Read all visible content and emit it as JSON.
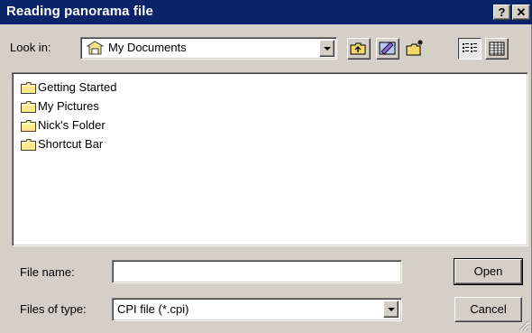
{
  "window": {
    "title": "Reading panorama file",
    "help_glyph": "?",
    "close_glyph": "✕"
  },
  "lookin": {
    "label": "Look in:",
    "value": "My Documents",
    "icon": "my-documents-icon"
  },
  "toolbar": [
    "up-one-level-icon",
    "desktop-icon",
    "new-folder-icon",
    "list-view-icon",
    "details-view-icon"
  ],
  "files": [
    {
      "name": "Getting Started",
      "icon": "folder-icon"
    },
    {
      "name": "My Pictures",
      "icon": "folder-icon"
    },
    {
      "name": "Nick's Folder",
      "icon": "folder-icon"
    },
    {
      "name": "Shortcut Bar",
      "icon": "folder-icon"
    }
  ],
  "filename": {
    "label": "File name:",
    "value": ""
  },
  "filetype": {
    "label": "Files of type:",
    "value": "CPI file (*.cpi)"
  },
  "buttons": {
    "open": "Open",
    "cancel": "Cancel"
  },
  "colors": {
    "titlebar": "#0a246a",
    "face": "#d4d0c8",
    "folder": "#ffe88a"
  }
}
